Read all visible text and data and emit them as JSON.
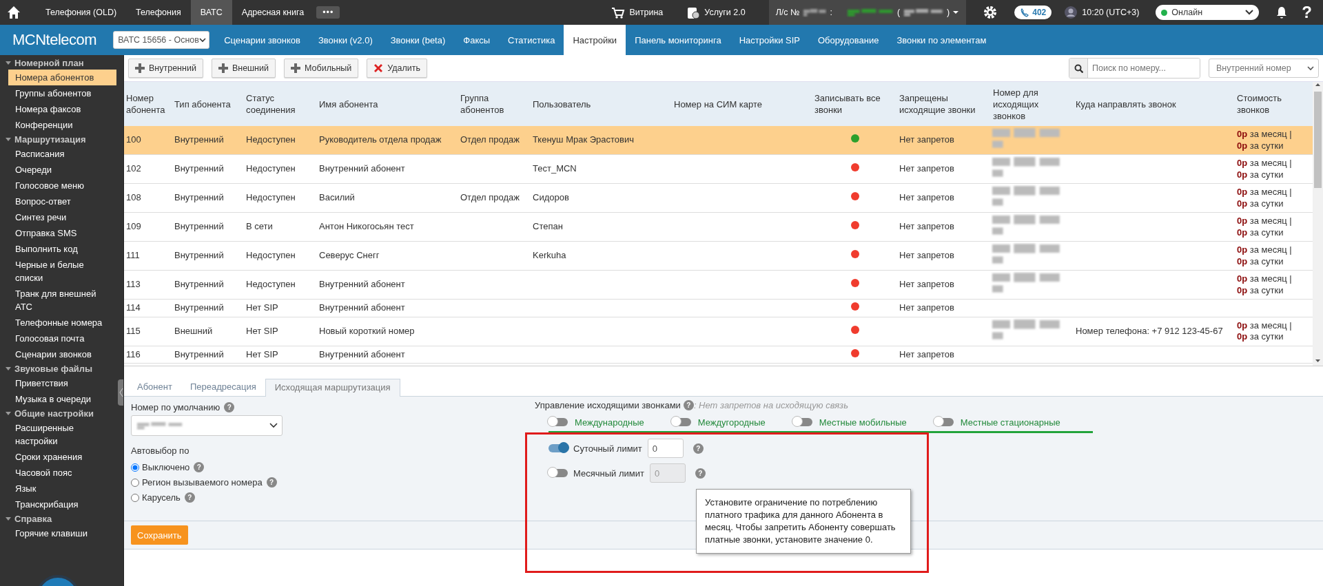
{
  "topbar": {
    "items": [
      {
        "label": "Телефония (OLD)",
        "selected": false
      },
      {
        "label": "Телефония",
        "selected": false
      },
      {
        "label": "ВАТС",
        "selected": true
      },
      {
        "label": "Адресная книга",
        "selected": false
      }
    ],
    "more": "•••",
    "links": [
      "Витрина",
      "Услуги 2.0"
    ],
    "account": {
      "label": "Л/с №",
      "separator": ":",
      "open": "(",
      "close": ")"
    },
    "calls_badge": "402",
    "time": "10:20 (UTC+3)",
    "status": {
      "label": "Онлайн",
      "color": "#22b14c"
    },
    "help": "?"
  },
  "navbar": {
    "logo": "MCNtelecom",
    "vpbx_select": "ВАТС 15656 - Основ",
    "tabs": [
      {
        "label": "Сценарии звонков",
        "selected": false
      },
      {
        "label": "Звонки (v2.0)",
        "selected": false
      },
      {
        "label": "Звонки (beta)",
        "selected": false
      },
      {
        "label": "Факсы",
        "selected": false
      },
      {
        "label": "Статистика",
        "selected": false
      },
      {
        "label": "Настройки",
        "selected": true
      },
      {
        "label": "Панель мониторинга",
        "selected": false
      },
      {
        "label": "Настройки SIP",
        "selected": false
      },
      {
        "label": "Оборудование",
        "selected": false
      },
      {
        "label": "Звонки по элементам",
        "selected": false
      }
    ]
  },
  "sidebar": {
    "groups": [
      {
        "label": "Номерной план",
        "expanded": true,
        "items": [
          {
            "label": "Номера абонентов",
            "selected": true
          },
          {
            "label": "Группы абонентов",
            "selected": false
          },
          {
            "label": "Номера факсов",
            "selected": false
          },
          {
            "label": "Конференции",
            "selected": false
          }
        ]
      },
      {
        "label": "Маршрутизация",
        "expanded": true,
        "items": [
          {
            "label": "Расписания",
            "selected": false
          },
          {
            "label": "Очереди",
            "selected": false
          },
          {
            "label": "Голосовое меню",
            "selected": false
          },
          {
            "label": "Вопрос-ответ",
            "selected": false
          },
          {
            "label": "Синтез речи",
            "selected": false
          },
          {
            "label": "Отправка SMS",
            "selected": false
          },
          {
            "label": "Выполнить код",
            "selected": false
          },
          {
            "label": "Черные и белые списки",
            "selected": false
          },
          {
            "label": "Транк для внешней АТС",
            "selected": false
          },
          {
            "label": "Телефонные номера",
            "selected": false
          },
          {
            "label": "Голосовая почта",
            "selected": false
          },
          {
            "label": "Сценарии звонков",
            "selected": false
          }
        ]
      },
      {
        "label": "Звуковые файлы",
        "expanded": true,
        "items": [
          {
            "label": "Приветствия",
            "selected": false
          },
          {
            "label": "Музыка в очереди",
            "selected": false
          }
        ]
      },
      {
        "label": "Общие настройки",
        "expanded": true,
        "items": [
          {
            "label": "Расширенные настройки",
            "selected": false
          },
          {
            "label": "Сроки хранения",
            "selected": false
          },
          {
            "label": "Часовой пояс",
            "selected": false
          },
          {
            "label": "Язык",
            "selected": false
          },
          {
            "label": "Транскрибация",
            "selected": false
          }
        ]
      },
      {
        "label": "Справка",
        "expanded": true,
        "items": [
          {
            "label": "Горячие клавиши",
            "selected": false
          }
        ]
      }
    ]
  },
  "toolbar": {
    "buttons": [
      {
        "label": "Внутренний",
        "kind": "add"
      },
      {
        "label": "Внешний",
        "kind": "add"
      },
      {
        "label": "Мобильный",
        "kind": "add"
      },
      {
        "label": "Удалить",
        "kind": "delete"
      }
    ],
    "search": {
      "placeholder": "Поиск по номеру..."
    },
    "filter_select": "Внутренний номер"
  },
  "table": {
    "columns": [
      "Номер абонента",
      "Тип абонента",
      "Статус соединения",
      "Имя абонента",
      "Группа абонентов",
      "Пользователь",
      "Номер на СИМ карте",
      "Записывать все звонки",
      "Запрещены исходящие звонки",
      "Номер для исходящих звонков",
      "Куда направлять звонок",
      "Стоимость звонков"
    ],
    "rows": [
      {
        "number": "100",
        "type": "Внутренний",
        "status": "Недоступен",
        "name": "Руководитель отдела продаж",
        "group": "Отдел продаж",
        "user": "Ткенуш Мрак Эрастович",
        "record_all": true,
        "outgoing_ban": "Нет запретов",
        "number_redacted": true,
        "cost": "**0р** за месяц | **0р** за сутки",
        "selected": true
      },
      {
        "number": "102",
        "type": "Внутренний",
        "status": "Недоступен",
        "name": "Внутренний абонент",
        "user": "Тест_MCN",
        "record_all": false,
        "outgoing_ban": "Нет запретов",
        "number_redacted": true,
        "cost": "**0р** за месяц | **0р** за сутки",
        "selected": false
      },
      {
        "number": "108",
        "type": "Внутренний",
        "status": "Недоступен",
        "name": "Василий",
        "group": "Отдел продаж",
        "user": "Сидоров",
        "record_all": false,
        "outgoing_ban": "Нет запретов",
        "number_redacted": true,
        "cost": "**0р** за месяц | **0р** за сутки",
        "selected": false
      },
      {
        "number": "109",
        "type": "Внутренний",
        "status": "В сети",
        "name": "Антон Никогосьян тест",
        "user": "Степан",
        "record_all": false,
        "outgoing_ban": "Нет запретов",
        "number_redacted": true,
        "cost": "**0р** за месяц | **0р** за сутки",
        "selected": false
      },
      {
        "number": "111",
        "type": "Внутренний",
        "status": "Недоступен",
        "name": "Северус Снегг",
        "user": "Kerkuha",
        "record_all": false,
        "outgoing_ban": "Нет запретов",
        "number_redacted": true,
        "cost": "**0р** за месяц | **0р** за сутки",
        "selected": false
      },
      {
        "number": "113",
        "type": "Внутренний",
        "status": "Недоступен",
        "name": "Внутренний абонент",
        "record_all": false,
        "outgoing_ban": "Нет запретов",
        "number_redacted": true,
        "cost": "**0р** за месяц | **0р** за сутки",
        "selected": false
      },
      {
        "number": "114",
        "type": "Внутренний",
        "status": "Нет SIP",
        "name": "Внутренний абонент",
        "record_all": false,
        "outgoing_ban": "Нет запретов",
        "number_redacted": false,
        "selected": false
      },
      {
        "number": "115",
        "type": "Внешний",
        "status": "Нет SIP",
        "name": "Новый короткий номер",
        "record_all": false,
        "number_redacted": true,
        "route": "Номер телефона: +7 912 123-45-67",
        "cost": "**0р** за месяц | **0р** за сутки",
        "selected": false
      },
      {
        "number": "116",
        "type": "Внутренний",
        "status": "Нет SIP",
        "name": "Внутренний абонент",
        "record_all": false,
        "outgoing_ban": "Нет запретов",
        "number_redacted": false,
        "selected": false
      }
    ]
  },
  "detail": {
    "tabs": [
      {
        "label": "Абонент",
        "selected": false
      },
      {
        "label": "Переадресация",
        "selected": false
      },
      {
        "label": "Исходящая маршрутизация",
        "selected": true
      }
    ],
    "default_number": {
      "label": "Номер по умолчанию",
      "help": "?",
      "value_redacted": true
    },
    "autoselect": {
      "label": "Автовыбор по",
      "options": [
        {
          "label": "Выключено",
          "selected": true,
          "help": "?"
        },
        {
          "label": "Регион вызываемого номера",
          "selected": false,
          "help": "?"
        },
        {
          "label": "Карусель",
          "selected": false,
          "help": "?"
        }
      ]
    },
    "outgoing": {
      "label": "Управление исходящими звонками",
      "help": "?",
      "status": ": Нет запретов на исходящую связь",
      "categories": [
        {
          "label": "Международные",
          "on": false
        },
        {
          "label": "Междугородные",
          "on": false
        },
        {
          "label": "Местные мобильные",
          "on": false
        },
        {
          "label": "Местные стационарные",
          "on": false
        }
      ]
    },
    "limits": [
      {
        "label": "Суточный лимит",
        "on": true,
        "value": "0",
        "disabled": false,
        "help": "?"
      },
      {
        "label": "Месячный лимит",
        "on": false,
        "value": "0",
        "disabled": true,
        "help": "?"
      }
    ],
    "tooltip": "Установите ограничение по потреблению платного трафика для данного Абонента в месяц. Чтобы запретить Абоненту совершать платные звонки, установите значение 0.",
    "save": "Сохранить"
  }
}
